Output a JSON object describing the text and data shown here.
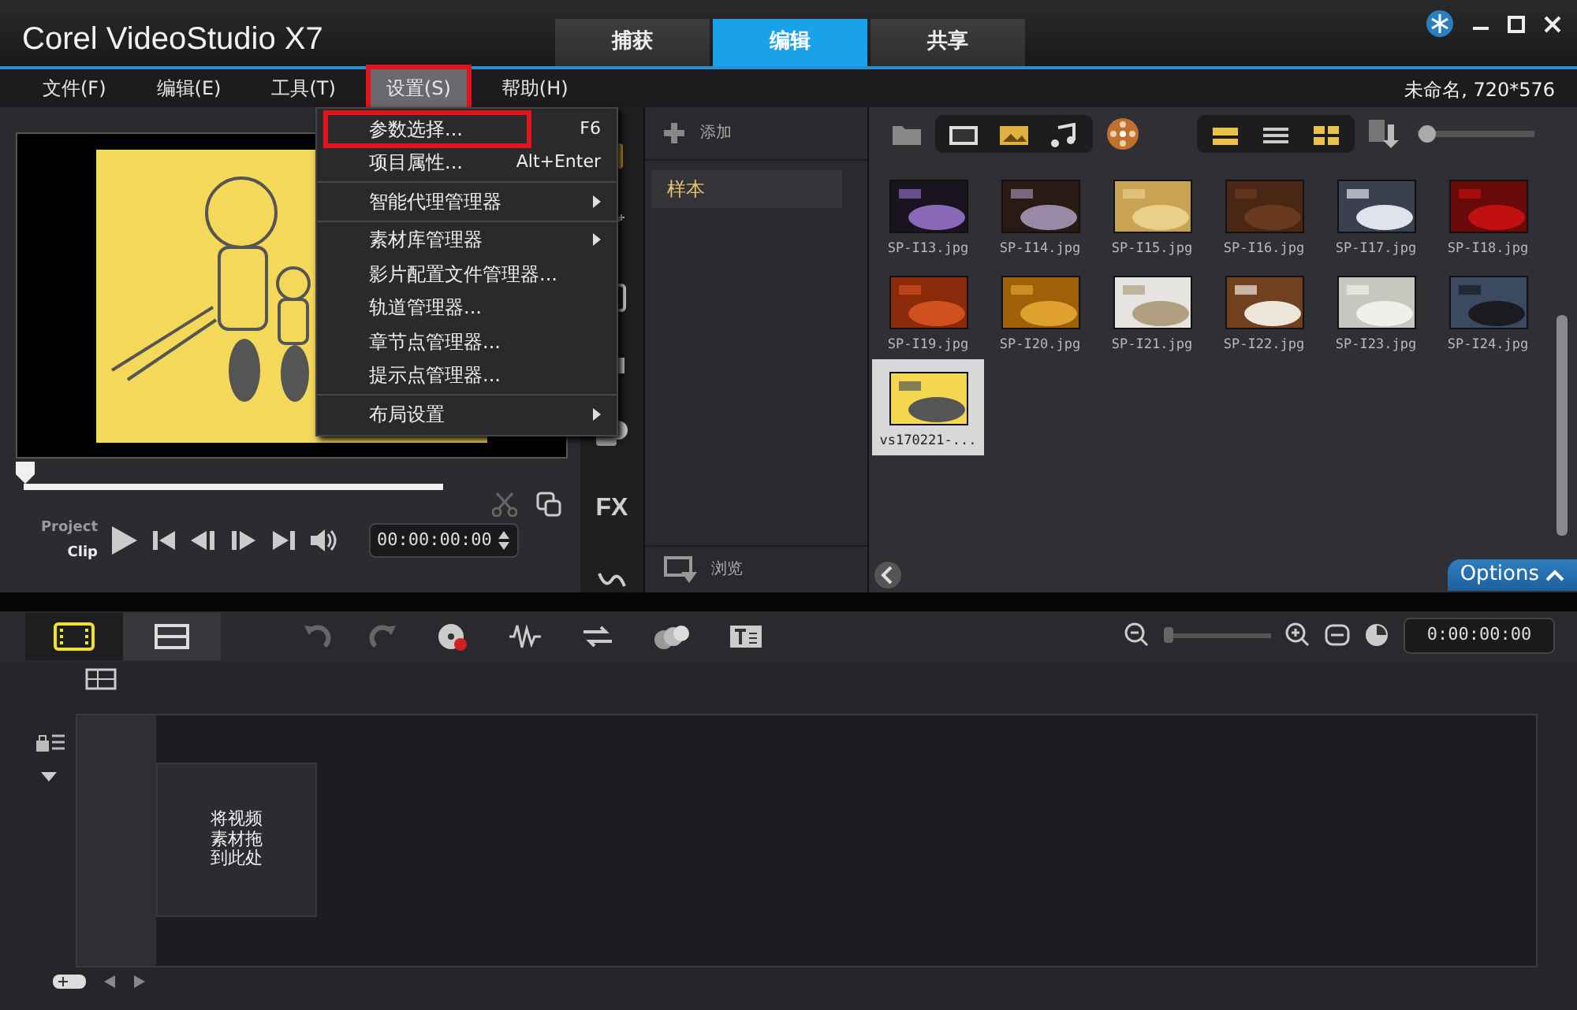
{
  "window": {
    "title": "Corel VideoStudio X7",
    "project_info": "未命名, 720*576"
  },
  "step_tabs": [
    {
      "label": "捕获",
      "selected": false
    },
    {
      "label": "编辑",
      "selected": true
    },
    {
      "label": "共享",
      "selected": false
    }
  ],
  "menu_bar": [
    {
      "label": "文件(F)",
      "open": false,
      "outlined": false
    },
    {
      "label": "编辑(E)",
      "open": false,
      "outlined": false
    },
    {
      "label": "工具(T)",
      "open": false,
      "outlined": false
    },
    {
      "label": "设置(S)",
      "open": true,
      "outlined": true
    },
    {
      "label": "帮助(H)",
      "open": false,
      "outlined": false
    }
  ],
  "open_menu": [
    {
      "kind": "item",
      "label": "参数选择...",
      "shortcut": "F6",
      "submenu": false,
      "outlined": true
    },
    {
      "kind": "item",
      "label": "项目属性...",
      "shortcut": "Alt+Enter",
      "submenu": false,
      "outlined": false
    },
    {
      "kind": "separator"
    },
    {
      "kind": "item",
      "label": "智能代理管理器",
      "submenu": true,
      "outlined": false
    },
    {
      "kind": "separator"
    },
    {
      "kind": "item",
      "label": "素材库管理器",
      "submenu": true,
      "outlined": false
    },
    {
      "kind": "item",
      "label": "影片配置文件管理器...",
      "submenu": false,
      "outlined": false
    },
    {
      "kind": "item",
      "label": "轨道管理器...",
      "submenu": false,
      "outlined": false
    },
    {
      "kind": "item",
      "label": "章节点管理器...",
      "submenu": false,
      "outlined": false
    },
    {
      "kind": "item",
      "label": "提示点管理器...",
      "submenu": false,
      "outlined": false
    },
    {
      "kind": "separator"
    },
    {
      "kind": "item",
      "label": "布局设置",
      "submenu": true,
      "outlined": false
    }
  ],
  "player": {
    "project_label": "Project",
    "clip_label": "Clip",
    "scrubber": {
      "level": 0
    },
    "timecode": "00:00:00:00"
  },
  "side_tabs": {
    "fx_label": "FX"
  },
  "library": {
    "add_label": "添加",
    "folders": [
      {
        "label": "样本",
        "selected": true
      }
    ],
    "browse_label": "浏览",
    "thumbnails": [
      {
        "label": "SP-I13.jpg",
        "selected": false
      },
      {
        "label": "SP-I14.jpg",
        "selected": false
      },
      {
        "label": "SP-I15.jpg",
        "selected": false
      },
      {
        "label": "SP-I16.jpg",
        "selected": false
      },
      {
        "label": "SP-I17.jpg",
        "selected": false
      },
      {
        "label": "SP-I18.jpg",
        "selected": false
      },
      {
        "label": "SP-I19.jpg",
        "selected": false
      },
      {
        "label": "SP-I20.jpg",
        "selected": false
      },
      {
        "label": "SP-I21.jpg",
        "selected": false
      },
      {
        "label": "SP-I22.jpg",
        "selected": false
      },
      {
        "label": "SP-I23.jpg",
        "selected": false
      },
      {
        "label": "SP-I24.jpg",
        "selected": false
      },
      {
        "label": "vs170221-...",
        "selected": true
      }
    ],
    "options_label": "Options"
  },
  "thumbnail_size_slider": {
    "level": 0
  },
  "timeline": {
    "storyboard_selected": true,
    "zoom_slider": {
      "level": 0
    },
    "timecode": "0:00:00:00",
    "drop_hint": "将视频素材拖到此处"
  }
}
